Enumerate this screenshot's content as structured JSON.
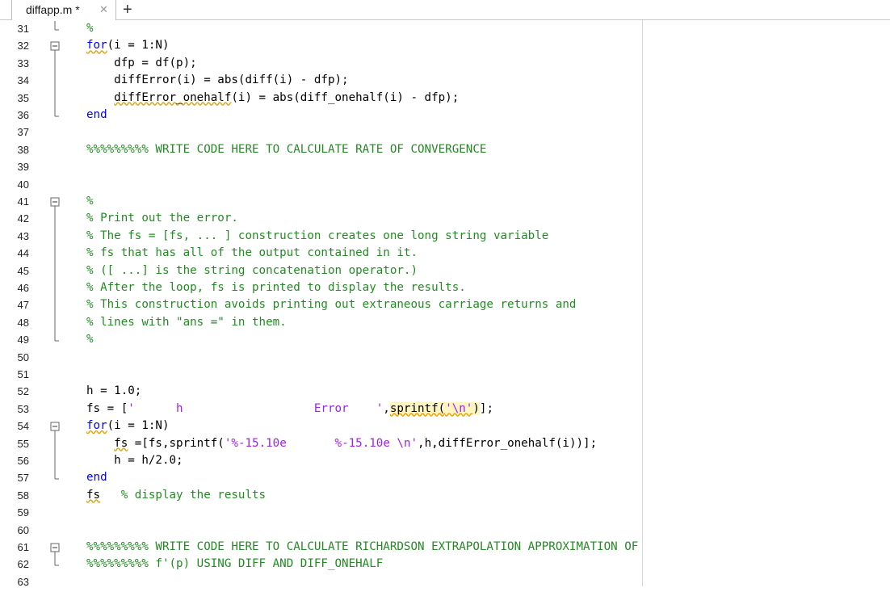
{
  "tab": {
    "title": "diffapp.m *",
    "close_glyph": "✕",
    "add_glyph": "+"
  },
  "lines": [
    {
      "n": "31",
      "fold": "end",
      "parts": [
        {
          "t": "%",
          "c": "cm"
        }
      ]
    },
    {
      "n": "32",
      "fold": "start",
      "parts": [
        {
          "t": "for",
          "c": "kw sq"
        },
        {
          "t": "(i = 1:N)",
          "c": ""
        }
      ]
    },
    {
      "n": "33",
      "fold": "mid",
      "parts": [
        {
          "t": "    dfp = df(p);",
          "c": ""
        }
      ]
    },
    {
      "n": "34",
      "fold": "mid",
      "parts": [
        {
          "t": "    diffError(i) = abs(diff(i) - dfp);",
          "c": ""
        }
      ]
    },
    {
      "n": "35",
      "fold": "mid",
      "parts": [
        {
          "t": "    ",
          "c": ""
        },
        {
          "t": "diffError_onehalf",
          "c": "sq"
        },
        {
          "t": "(i) = abs(diff_onehalf(i) - dfp);",
          "c": ""
        }
      ]
    },
    {
      "n": "36",
      "fold": "end",
      "parts": [
        {
          "t": "end",
          "c": "kw"
        }
      ]
    },
    {
      "n": "37",
      "fold": "",
      "parts": []
    },
    {
      "n": "38",
      "fold": "",
      "parts": [
        {
          "t": "%%%%%%%%% WRITE CODE HERE TO CALCULATE RATE OF CONVERGENCE",
          "c": "cm"
        }
      ]
    },
    {
      "n": "39",
      "fold": "",
      "parts": []
    },
    {
      "n": "40",
      "fold": "",
      "parts": []
    },
    {
      "n": "41",
      "fold": "start",
      "parts": [
        {
          "t": "%",
          "c": "cm"
        }
      ]
    },
    {
      "n": "42",
      "fold": "mid",
      "parts": [
        {
          "t": "% Print out the error.",
          "c": "cm"
        }
      ]
    },
    {
      "n": "43",
      "fold": "mid",
      "parts": [
        {
          "t": "% The fs = [fs, ... ] construction creates one long string variable",
          "c": "cm"
        }
      ]
    },
    {
      "n": "44",
      "fold": "mid",
      "parts": [
        {
          "t": "% fs that has all of the output contained in it.",
          "c": "cm"
        }
      ]
    },
    {
      "n": "45",
      "fold": "mid",
      "parts": [
        {
          "t": "% ([ ...] is the string concatenation operator.)",
          "c": "cm"
        }
      ]
    },
    {
      "n": "46",
      "fold": "mid",
      "parts": [
        {
          "t": "% After the loop, fs is printed to display the results.",
          "c": "cm"
        }
      ]
    },
    {
      "n": "47",
      "fold": "mid",
      "parts": [
        {
          "t": "% This construction avoids printing out extraneous carriage returns and",
          "c": "cm"
        }
      ]
    },
    {
      "n": "48",
      "fold": "mid",
      "parts": [
        {
          "t": "% lines with \"ans =\" in them.",
          "c": "cm"
        }
      ]
    },
    {
      "n": "49",
      "fold": "end",
      "parts": [
        {
          "t": "%",
          "c": "cm"
        }
      ]
    },
    {
      "n": "50",
      "fold": "",
      "parts": []
    },
    {
      "n": "51",
      "fold": "",
      "parts": []
    },
    {
      "n": "52",
      "fold": "",
      "parts": [
        {
          "t": "h = 1.0;",
          "c": ""
        }
      ]
    },
    {
      "n": "53",
      "fold": "",
      "parts": [
        {
          "t": "fs = [",
          "c": ""
        },
        {
          "t": "'      h                   Error    '",
          "c": "str"
        },
        {
          "t": ",",
          "c": ""
        },
        {
          "t": "sprintf(",
          "c": "hl sq"
        },
        {
          "t": "'\\n'",
          "c": "str hl sq"
        },
        {
          "t": ")",
          "c": "hl"
        },
        {
          "t": "];",
          "c": ""
        }
      ]
    },
    {
      "n": "54",
      "fold": "start",
      "parts": [
        {
          "t": "for",
          "c": "kw sq"
        },
        {
          "t": "(i = 1:N)",
          "c": ""
        }
      ]
    },
    {
      "n": "55",
      "fold": "mid",
      "parts": [
        {
          "t": "    ",
          "c": ""
        },
        {
          "t": "fs",
          "c": "sq"
        },
        {
          "t": " =[fs,sprintf(",
          "c": ""
        },
        {
          "t": "'%-15.10e       %-15.10e \\n'",
          "c": "str"
        },
        {
          "t": ",h,diffError_onehalf(i))];",
          "c": ""
        }
      ]
    },
    {
      "n": "56",
      "fold": "mid",
      "parts": [
        {
          "t": "    h = h/2.0;",
          "c": ""
        }
      ]
    },
    {
      "n": "57",
      "fold": "end",
      "parts": [
        {
          "t": "end",
          "c": "kw"
        }
      ]
    },
    {
      "n": "58",
      "fold": "",
      "parts": [
        {
          "t": "fs",
          "c": "sq"
        },
        {
          "t": "   ",
          "c": ""
        },
        {
          "t": "% display the results",
          "c": "cm"
        }
      ]
    },
    {
      "n": "59",
      "fold": "",
      "parts": []
    },
    {
      "n": "60",
      "fold": "",
      "parts": []
    },
    {
      "n": "61",
      "fold": "start",
      "parts": [
        {
          "t": "%%%%%%%%% WRITE CODE HERE TO CALCULATE RICHARDSON EXTRAPOLATION APPROXIMATION OF",
          "c": "cm"
        }
      ]
    },
    {
      "n": "62",
      "fold": "end",
      "parts": [
        {
          "t": "%%%%%%%%% f'(p) USING DIFF AND DIFF_ONEHALF",
          "c": "cm"
        }
      ]
    },
    {
      "n": "63",
      "fold": "",
      "parts": []
    }
  ]
}
